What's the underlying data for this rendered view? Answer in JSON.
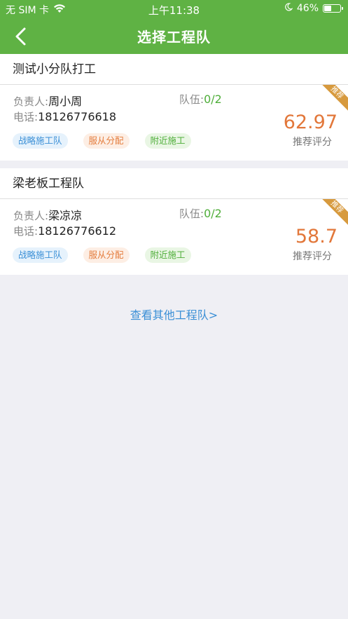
{
  "status_bar": {
    "carrier": "无 SIM 卡",
    "time": "上午11:38",
    "battery": "46%",
    "battery_level": 0.46
  },
  "nav": {
    "title": "选择工程队"
  },
  "teams": [
    {
      "name": "测试小分队打工",
      "leader_label": "负责人:",
      "leader": "周小周",
      "team_label": "队伍:",
      "team_count": "0/2",
      "phone_label": "电话:",
      "phone": "18126776618",
      "tags": [
        "战略施工队",
        "服从分配",
        "附近施工"
      ],
      "score": "62.97",
      "score_label": "推荐评分",
      "ribbon": "推荐"
    },
    {
      "name": "梁老板工程队",
      "leader_label": "负责人:",
      "leader": "梁凉凉",
      "team_label": "队伍:",
      "team_count": "0/2",
      "phone_label": "电话:",
      "phone": "18126776612",
      "tags": [
        "战略施工队",
        "服从分配",
        "附近施工"
      ],
      "score": "58.7",
      "score_label": "推荐评分",
      "ribbon": "推荐"
    }
  ],
  "more_link": "查看其他工程队>",
  "colors": {
    "header_green": "#5fb244",
    "score_orange": "#e2773a",
    "link_blue": "#3a8fd6",
    "ribbon_gold": "#d79a3e"
  },
  "icons": [
    "wifi-icon",
    "moon-icon",
    "battery-icon",
    "back-arrow-icon"
  ]
}
